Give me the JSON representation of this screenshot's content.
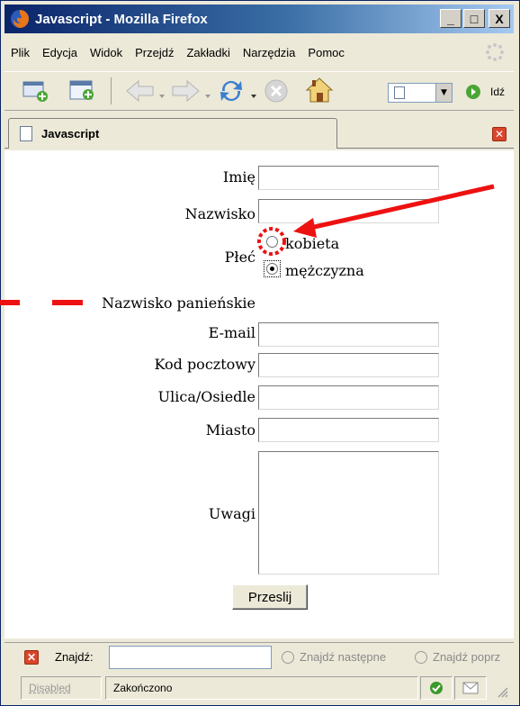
{
  "window": {
    "title": "Javascript - Mozilla Firefox",
    "buttons": [
      "_",
      "□",
      "X"
    ]
  },
  "menubar": {
    "items": [
      {
        "label": "Plik"
      },
      {
        "label": "Edycja"
      },
      {
        "label": "Widok"
      },
      {
        "label": "Przejdź"
      },
      {
        "label": "Zakładki"
      },
      {
        "label": "Narzędzia"
      },
      {
        "label": "Pomoc"
      }
    ]
  },
  "toolbar": {
    "go_label": "Idź"
  },
  "tab": {
    "title": "Javascript"
  },
  "form": {
    "first_name_label": "Imię",
    "last_name_label": "Nazwisko",
    "gender_label": "Płeć",
    "gender_option_female": "kobieta",
    "gender_option_male": "mężczyzna",
    "gender_selected": "mężczyzna",
    "maiden_name_label": "Nazwisko panieńskie",
    "email_label": "E-mail",
    "postal_code_label": "Kod pocztowy",
    "street_label": "Ulica/Osiedle",
    "city_label": "Miasto",
    "notes_label": "Uwagi",
    "submit_label": "Przeslij"
  },
  "findbar": {
    "label": "Znajdź:",
    "next_label": "Znajdź następne",
    "prev_label": "Znajdź poprz"
  },
  "statusbar": {
    "disabled_label": "Disabled",
    "status_text": "Zakończono"
  },
  "annotation": {
    "color": "#ee1111"
  }
}
